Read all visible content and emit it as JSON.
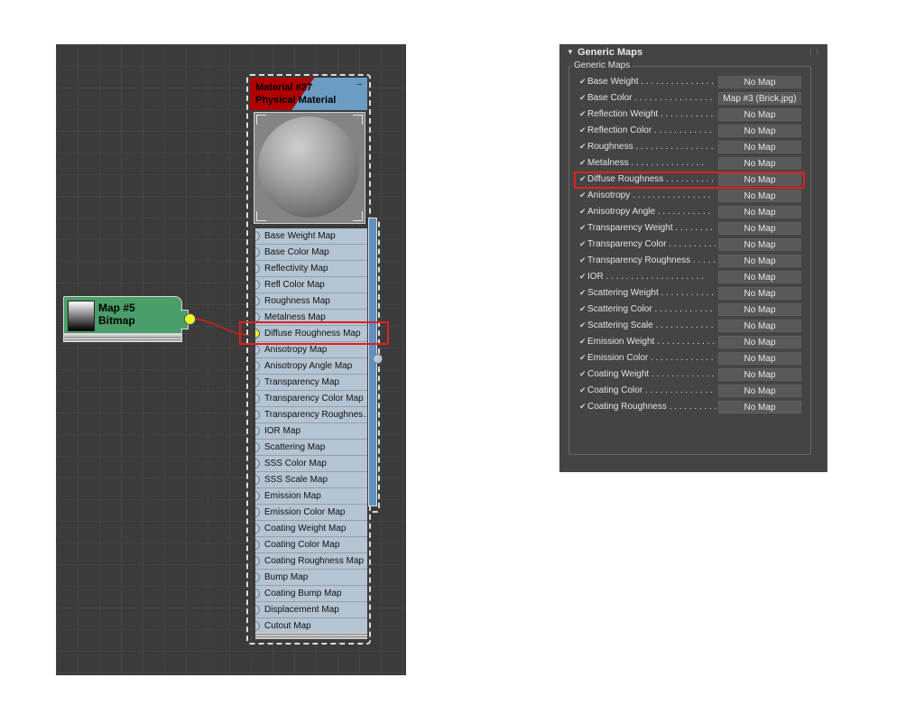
{
  "node_editor": {
    "bitmap_node": {
      "name": "Map #5",
      "type": "Bitmap"
    },
    "material_node": {
      "name": "Material #27",
      "type": "Physical Material",
      "menu": "–",
      "sockets": [
        "Base Weight Map",
        "Base Color Map",
        "Reflectivity Map",
        "Refl Color Map",
        "Roughness Map",
        "Metalness Map",
        "Diffuse Roughness Map",
        "Anisotropy Map",
        "Anisotropy Angle Map",
        "Transparency Map",
        "Transparency Color Map",
        "Transparency Roughnes…",
        "IOR Map",
        "Scattering Map",
        "SSS Color Map",
        "SSS Scale Map",
        "Emission Map",
        "Emission Color Map",
        "Coating Weight Map",
        "Coating Color Map",
        "Coating Roughness Map",
        "Bump Map",
        "Coating Bump Map",
        "Displacement Map",
        "Cutout Map"
      ],
      "connected_socket": "Diffuse Roughness Map"
    }
  },
  "generic_maps": {
    "rollout_title": "Generic Maps",
    "group_label": "Generic Maps",
    "check_glyph": "✔",
    "rows": [
      {
        "label": "Base Weight . . . . . . . . . . . . . . .",
        "map": "No Map"
      },
      {
        "label": "Base Color . . . . . . . . . . . . . . . .",
        "map": "Map #3 (Brick.jpg)"
      },
      {
        "label": "Reflection Weight . . . . . . . . . . .",
        "map": "No Map"
      },
      {
        "label": "Reflection Color . . . . . . . . . . . .",
        "map": "No Map"
      },
      {
        "label": "Roughness . . . . . . . . . . . . . . . .",
        "map": "No Map"
      },
      {
        "label": "Metalness . . . . . . . . . . . . . . .",
        "map": "No Map"
      },
      {
        "label": "Diffuse Roughness . . . . . . . . . .",
        "map": "No Map"
      },
      {
        "label": "Anisotropy . . . . . . . . . . . . . . . .",
        "map": "No Map"
      },
      {
        "label": "Anisotropy Angle . . . . . . . . . . .",
        "map": "No Map"
      },
      {
        "label": "Transparency Weight . . . . . . . .",
        "map": "No Map"
      },
      {
        "label": "Transparency Color . . . . . . . . . .",
        "map": "No Map"
      },
      {
        "label": "Transparency Roughness . . . . . .",
        "map": "No Map"
      },
      {
        "label": "IOR . . . . . . . . . . . . . . . . . . . .",
        "map": "No Map"
      },
      {
        "label": "Scattering Weight . . . . . . . . . . .",
        "map": "No Map"
      },
      {
        "label": "Scattering Color . . . . . . . . . . . .",
        "map": "No Map"
      },
      {
        "label": "Scattering Scale . . . . . . . . . . . .",
        "map": "No Map"
      },
      {
        "label": "Emission Weight . . . . . . . . . . . .",
        "map": "No Map"
      },
      {
        "label": "Emission Color . . . . . . . . . . . . .",
        "map": "No Map"
      },
      {
        "label": "Coating Weight . . . . . . . . . . . . .",
        "map": "No Map"
      },
      {
        "label": "Coating Color . . . . . . . . . . . . . .",
        "map": "No Map"
      },
      {
        "label": "Coating Roughness . . . . . . . . . .",
        "map": "No Map"
      }
    ],
    "highlighted_row": "Diffuse Roughness"
  },
  "colors": {
    "highlight": "#e02020",
    "socket_active": "#e6ff2a",
    "bitmap_node": "#4a9e69",
    "material_header": "#b00000"
  }
}
